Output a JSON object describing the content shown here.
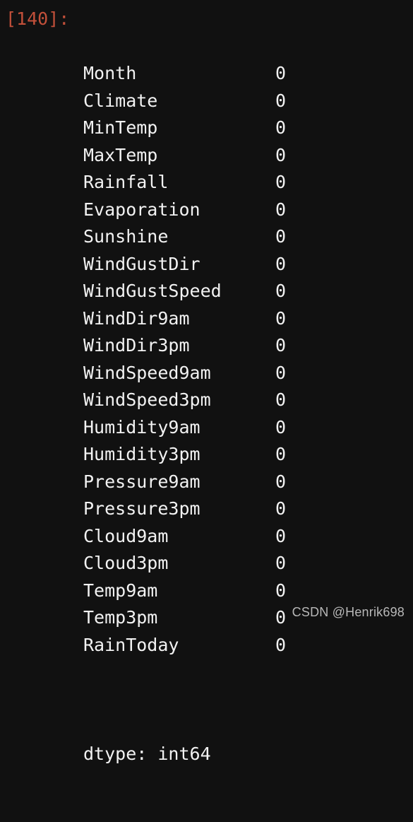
{
  "cell": {
    "prompt_label": "[140]:",
    "dtype_line": "dtype: int64"
  },
  "series": {
    "rows": [
      {
        "label": "Month",
        "value": "0"
      },
      {
        "label": "Climate",
        "value": "0"
      },
      {
        "label": "MinTemp",
        "value": "0"
      },
      {
        "label": "MaxTemp",
        "value": "0"
      },
      {
        "label": "Rainfall",
        "value": "0"
      },
      {
        "label": "Evaporation",
        "value": "0"
      },
      {
        "label": "Sunshine",
        "value": "0"
      },
      {
        "label": "WindGustDir",
        "value": "0"
      },
      {
        "label": "WindGustSpeed",
        "value": "0"
      },
      {
        "label": "WindDir9am",
        "value": "0"
      },
      {
        "label": "WindDir3pm",
        "value": "0"
      },
      {
        "label": "WindSpeed9am",
        "value": "0"
      },
      {
        "label": "WindSpeed3pm",
        "value": "0"
      },
      {
        "label": "Humidity9am",
        "value": "0"
      },
      {
        "label": "Humidity3pm",
        "value": "0"
      },
      {
        "label": "Pressure9am",
        "value": "0"
      },
      {
        "label": "Pressure3pm",
        "value": "0"
      },
      {
        "label": "Cloud9am",
        "value": "0"
      },
      {
        "label": "Cloud3pm",
        "value": "0"
      },
      {
        "label": "Temp9am",
        "value": "0"
      },
      {
        "label": "Temp3pm",
        "value": "0"
      },
      {
        "label": "RainToday",
        "value": "0"
      }
    ]
  },
  "watermark": {
    "text": "CSDN @Henrik698"
  },
  "colors": {
    "background": "#111111",
    "text": "#f2f2f2",
    "prompt": "#c3503a",
    "watermark": "#b8b8b8"
  }
}
